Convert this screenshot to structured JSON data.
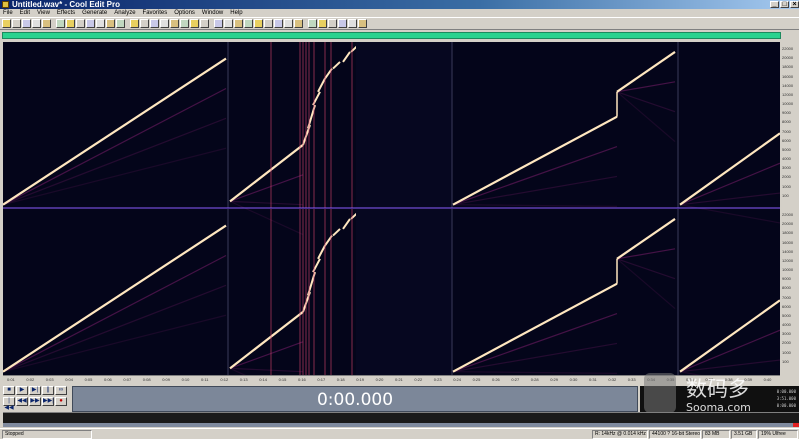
{
  "window": {
    "title": "Untitled.wav* - Cool Edit Pro",
    "controls": [
      "_",
      "□",
      "×"
    ]
  },
  "menu": {
    "items": [
      "File",
      "Edit",
      "View",
      "Effects",
      "Generate",
      "Analyze",
      "Favorites",
      "Options",
      "Window",
      "Help"
    ]
  },
  "toolbar": {
    "icons": [
      "new-icon",
      "open-icon",
      "save-icon",
      "undo-icon",
      "redo-icon",
      "copy-icon",
      "cut-icon",
      "paste-icon",
      "mix-paste-icon",
      "zoom-icon",
      "spectral-icon",
      "waveform-icon",
      "multitrack-icon",
      "cd-icon",
      "settings-icon",
      "metronome-icon",
      "envelope-icon",
      "filter-icon",
      "amplify-icon",
      "normalize-icon",
      "reverb-icon",
      "delay-icon",
      "flanger-icon",
      "chorus-icon",
      "distortion-icon",
      "noise-icon",
      "eq-icon",
      "pitch-icon",
      "stretch-icon",
      "tone-icon",
      "marker-icon",
      "snap-icon",
      "loop-icon",
      "scrub-icon",
      "help-icon"
    ]
  },
  "colors": {
    "overview": "#2ad38f",
    "background": "#04051a",
    "trace": "#ffe7c0",
    "harmonic": "#7a1e6a",
    "divider": "#8a5cff",
    "time_display": "#7c8799"
  },
  "spectrogram": {
    "channels": 2,
    "display_mode": "spectral",
    "right_ruler_ticks": [
      "22000",
      "20000",
      "18000",
      "16000",
      "14000",
      "12000",
      "10000",
      "9000",
      "8000",
      "7000",
      "6000",
      "5000",
      "4000",
      "3000",
      "2000",
      "1000",
      "100"
    ],
    "time_ruler_ticks": [
      "0:01",
      "0:02",
      "0:03",
      "0:04",
      "0:05",
      "0:06",
      "0:07",
      "0:08",
      "0:09",
      "0:10",
      "0:11",
      "0:12",
      "0:13",
      "0:14",
      "0:15",
      "0:16",
      "0:17",
      "0:18",
      "0:19",
      "0:20",
      "0:21",
      "0:22",
      "0:23",
      "0:24",
      "0:25",
      "0:26",
      "0:27",
      "0:28",
      "0:29",
      "0:30",
      "0:31",
      "0:32",
      "0:33",
      "0:34",
      "0:35",
      "0:36",
      "0:37",
      "0:38",
      "0:39",
      "0:40"
    ]
  },
  "transport": {
    "buttons": [
      "■",
      "▶",
      "▶|",
      "||",
      "●",
      "∞",
      "|◀◀",
      "◀◀",
      "▶▶",
      "▶▶|",
      "●"
    ]
  },
  "time_display": {
    "value": "0:00.000"
  },
  "info_panel": {
    "begin": "0:00.000",
    "end": "3:51.000",
    "view": "0:00.000"
  },
  "watermark": {
    "title": "数码多",
    "subtitle": "Sooma.com"
  },
  "status": {
    "state": "Stopped",
    "fields": [
      "R: 14kHz  @  0.014 kHz",
      "44100  ?  16-bit  Stereo",
      "83 MB",
      "3.51 GB",
      "19% Ulfree"
    ]
  }
}
